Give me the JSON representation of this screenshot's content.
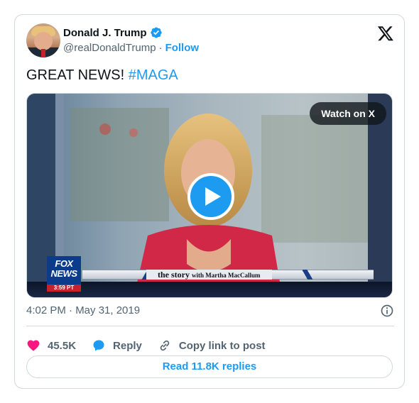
{
  "author": {
    "display_name": "Donald J. Trump",
    "handle": "@realDonaldTrump",
    "separator": "·",
    "follow_label": "Follow",
    "verified_icon": "verified-badge-icon"
  },
  "tweet": {
    "text": "GREAT NEWS! ",
    "hashtag": "#MAGA"
  },
  "media": {
    "watch_label": "Watch on X",
    "play_icon": "play-icon",
    "network_logo_line1": "FOX",
    "network_logo_line2": "NEWS",
    "network_time": "3:59 PT",
    "show_title": "the story",
    "show_host": "with Martha MacCallum"
  },
  "timestamp": "4:02 PM · May 31, 2019",
  "actions": {
    "like_count": "45.5K",
    "reply_label": "Reply",
    "copy_link_label": "Copy link to post"
  },
  "read_replies_label": "Read 11.8K replies",
  "colors": {
    "accent": "#1d9bf0",
    "like": "#f91880",
    "text_primary": "#0f1419",
    "text_secondary": "#536471",
    "border": "#cfd9de"
  }
}
